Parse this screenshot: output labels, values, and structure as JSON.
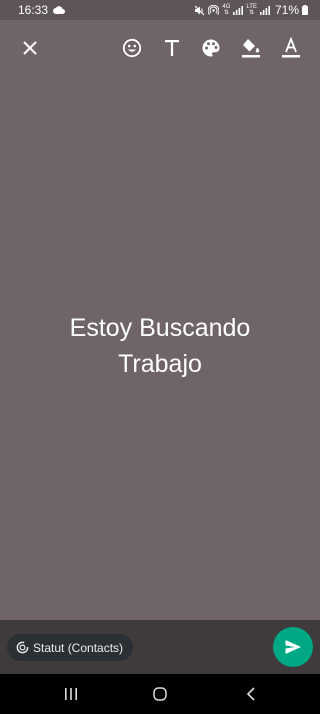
{
  "status_bar": {
    "time": "16:33",
    "battery": "71%",
    "icons": [
      "cloud-icon",
      "mute-icon",
      "hotspot-icon",
      "data-4g-icon",
      "data-lte-icon",
      "signal-icon",
      "battery-icon"
    ],
    "network_4g": "4G",
    "network_lte": "LTE"
  },
  "toolbar": {
    "icons": [
      "close-icon",
      "emoji-icon",
      "text-font-icon",
      "palette-icon",
      "fill-color-icon",
      "text-color-icon"
    ]
  },
  "canvas": {
    "background_color": "#6f6566",
    "text": "Estoy Buscando\nTrabajo"
  },
  "footer": {
    "audience_label": "Statut (Contacts)",
    "audience_icon": "status-ring-icon",
    "send_icon": "send-icon",
    "accent_color": "#00a884"
  },
  "nav_bar": {
    "icons": [
      "recent-apps-icon",
      "home-icon",
      "back-icon"
    ]
  }
}
